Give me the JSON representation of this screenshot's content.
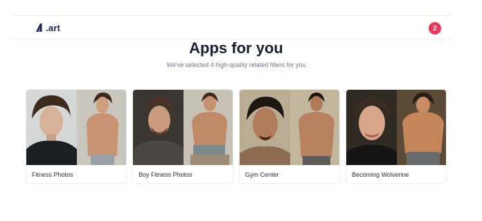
{
  "header": {
    "logo_mark": "A",
    "logo_text": ".art",
    "notification_count": "2",
    "notification_color": "#e8395c"
  },
  "main": {
    "title": "Apps for you",
    "subtitle": "We've selected 4 high-quality related filters for you"
  },
  "cards": [
    {
      "label": "Fitness Photos",
      "before_bg": "#d6d8d8",
      "after_bg": "#c9c6bd"
    },
    {
      "label": "Boy Fitness Photos",
      "before_bg": "#3a3530",
      "after_bg": "#c7c1b6"
    },
    {
      "label": "Gym Center",
      "before_bg": "#b9ad93",
      "after_bg": "#c2b79c"
    },
    {
      "label": "Becoming Wolverine",
      "before_bg": "#2f2a22",
      "after_bg": "#5a4a36"
    }
  ]
}
